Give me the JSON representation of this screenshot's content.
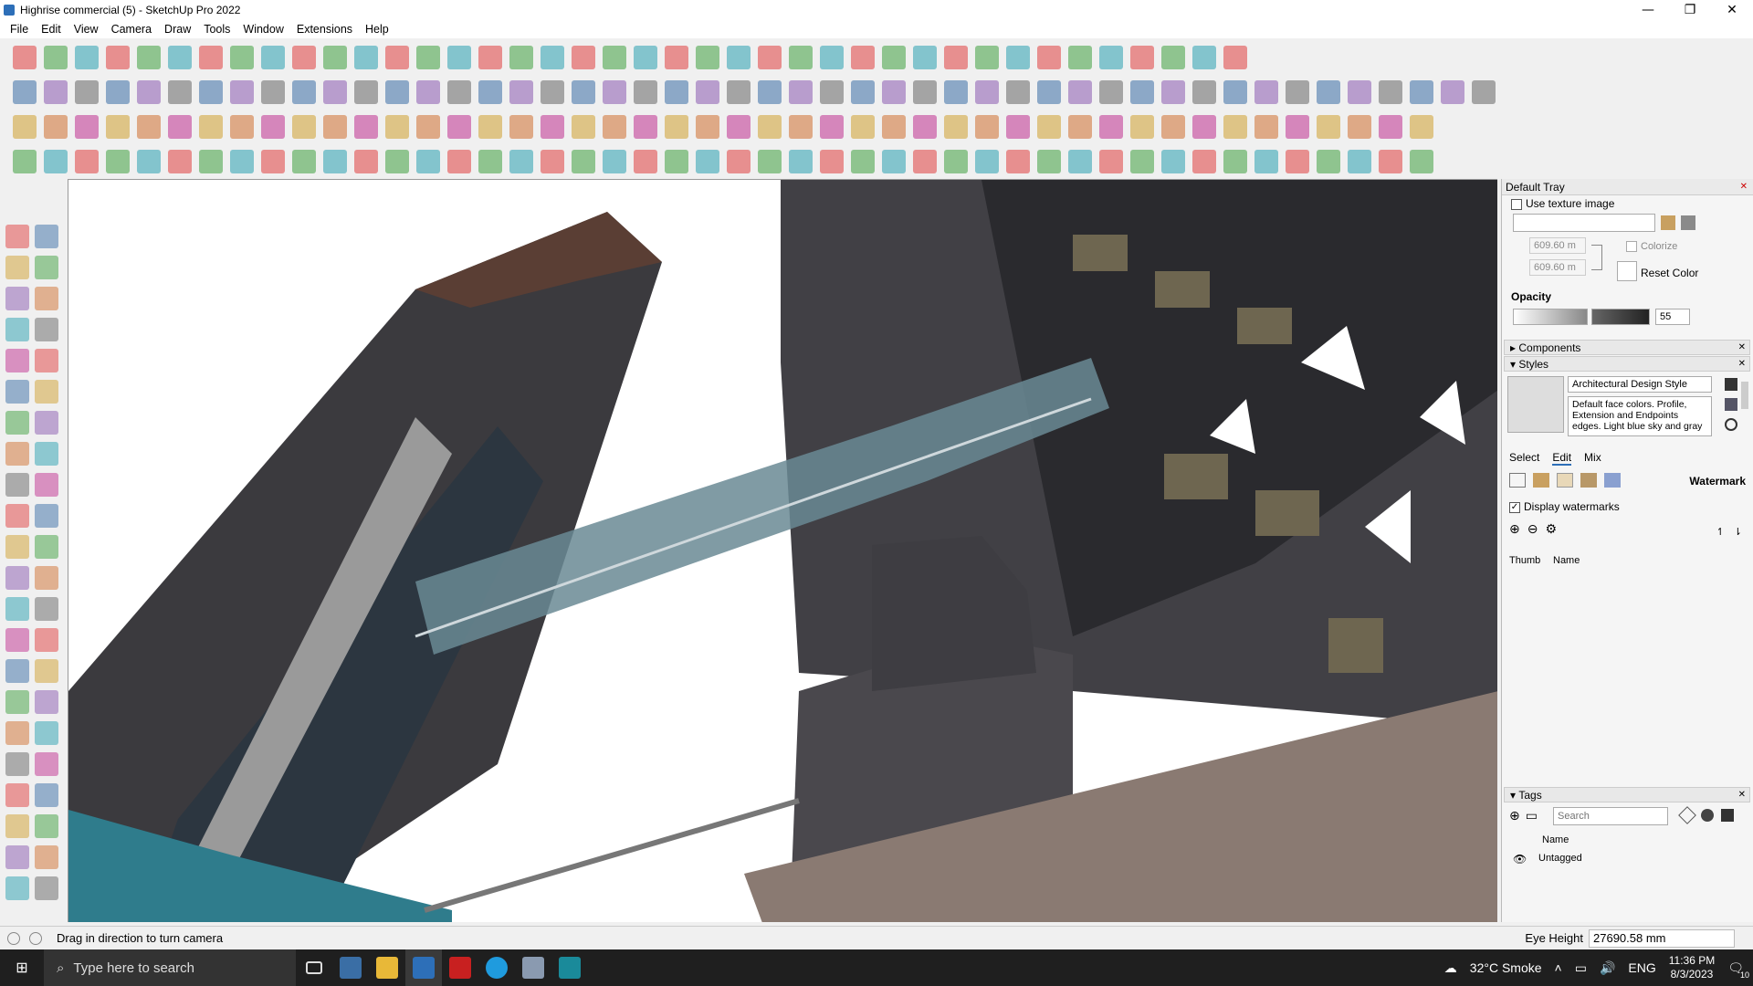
{
  "window": {
    "title": "Highrise commercial (5) - SketchUp Pro 2022",
    "minimize_glyph": "—",
    "restore_glyph": "❐",
    "close_glyph": "✕"
  },
  "menu": [
    "File",
    "Edit",
    "View",
    "Camera",
    "Draw",
    "Tools",
    "Window",
    "Extensions",
    "Help"
  ],
  "tray": {
    "title": "Default Tray",
    "use_texture_label": "Use texture image",
    "width_value": "609.60 m",
    "height_value": "609.60 m",
    "colorize_label": "Colorize",
    "reset_color_label": "Reset Color",
    "opacity_label": "Opacity",
    "opacity_value": "55",
    "components_label": "Components",
    "styles_label": "Styles",
    "style_name": "Architectural Design Style",
    "style_description": "Default face colors. Profile, Extension and Endpoints edges. Light blue sky and gray",
    "tabs": [
      "Select",
      "Edit",
      "Mix"
    ],
    "active_tab": "Edit",
    "watermark_label": "Watermark",
    "display_watermarks_label": "Display watermarks",
    "col_thumb": "Thumb",
    "col_name": "Name",
    "tags_label": "Tags",
    "tags_search_placeholder": "Search",
    "tags_col_name": "Name",
    "tag_untagged": "Untagged"
  },
  "status": {
    "message": "Drag in direction to turn camera",
    "eye_height_label": "Eye Height",
    "eye_height_value": "27690.58 mm"
  },
  "taskbar": {
    "search_placeholder": "Type here to search",
    "weather": "32°C  Smoke",
    "language": "ENG",
    "time": "11:36 PM",
    "date": "8/3/2023",
    "notification_count": "10"
  },
  "colors": {
    "building_dark": "#3a3a3e",
    "glass": "#6a8a94",
    "teal_base": "#2f7c8c",
    "brick": "#8a7a72",
    "accent_blue": "#2d6fb8"
  }
}
